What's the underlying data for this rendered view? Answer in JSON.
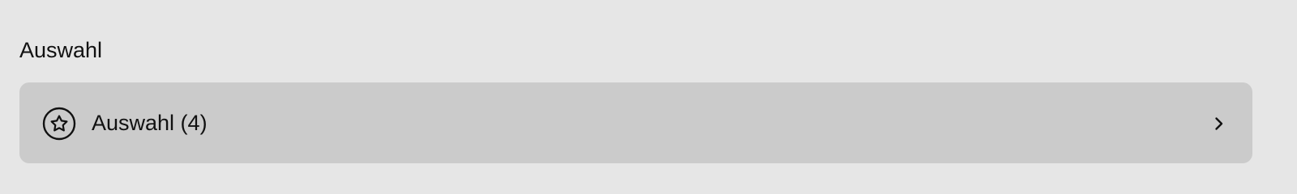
{
  "section": {
    "title": "Auswahl",
    "row": {
      "label": "Auswahl (4)",
      "icon": "star-circle-icon",
      "chevron_icon": "chevron-right-icon"
    }
  },
  "colors": {
    "background": "#e6e6e6",
    "row_background": "#cbcbcb",
    "text": "#111111"
  }
}
